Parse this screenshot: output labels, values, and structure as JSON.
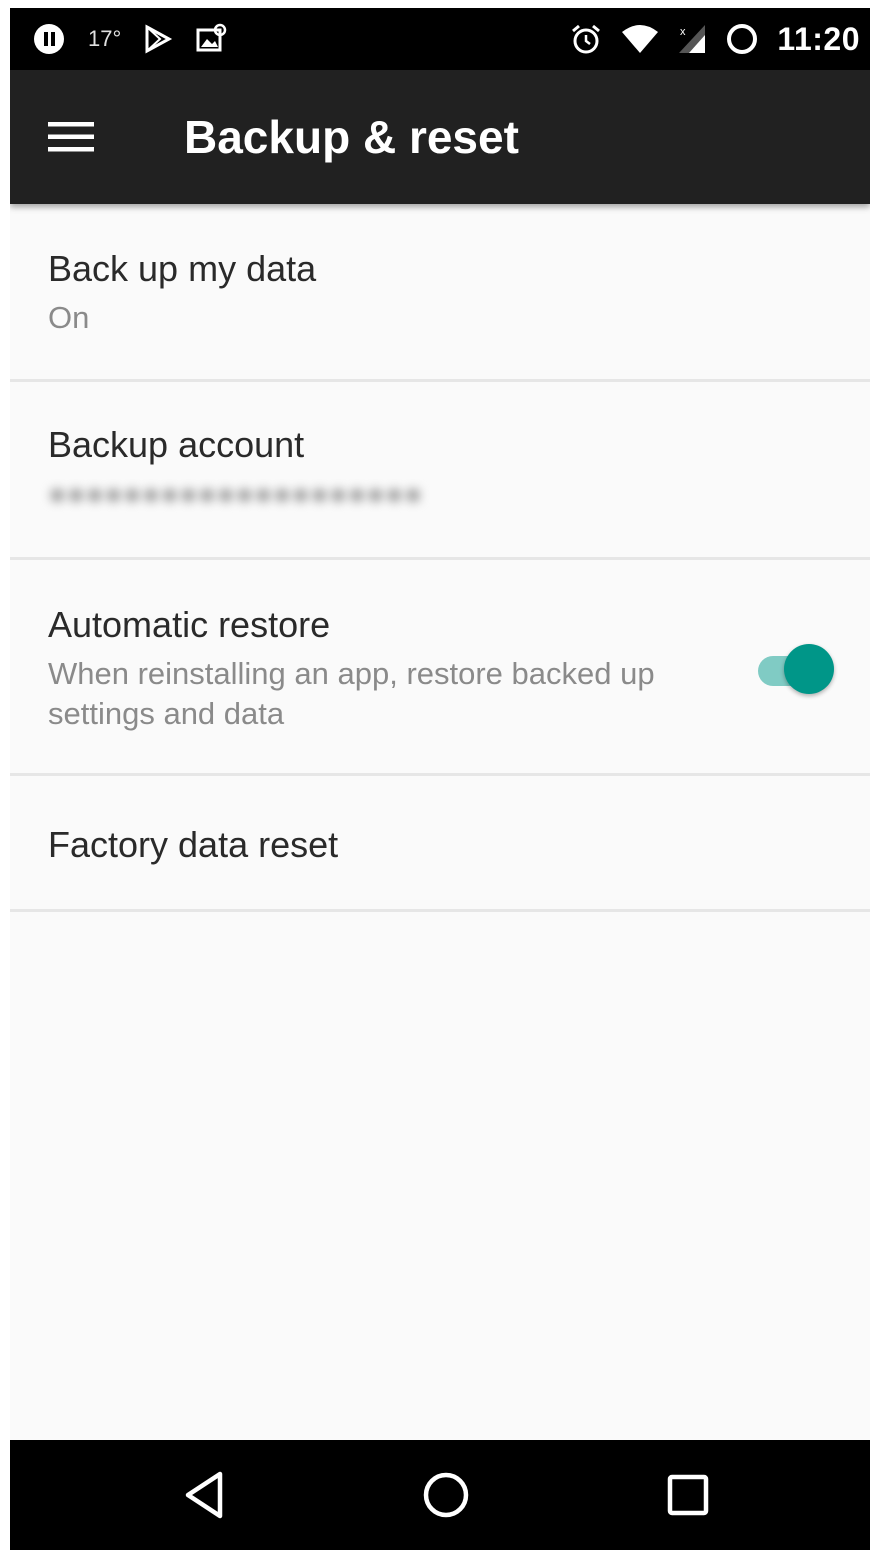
{
  "status_bar": {
    "time": "11:20",
    "temperature": "17°",
    "icons": [
      "notification-icon",
      "weather-icon",
      "play-store-icon",
      "photo-icon",
      "alarm-icon",
      "wifi-icon",
      "signal-icon",
      "battery-icon"
    ]
  },
  "app_bar": {
    "title": "Backup & reset",
    "menu_icon": "hamburger-menu-icon"
  },
  "settings": {
    "backup_data": {
      "title": "Back up my data",
      "summary": "On"
    },
    "backup_account": {
      "title": "Backup account",
      "summary": "●●●●●●●●●●●●●●●●●●●●"
    },
    "automatic_restore": {
      "title": "Automatic restore",
      "summary": "When reinstalling an app, restore backed up settings and data",
      "enabled": true
    },
    "factory_reset": {
      "title": "Factory data reset"
    }
  },
  "colors": {
    "accent": "#009688",
    "accent_light": "#80cbc4",
    "toolbar": "#212121",
    "status_bar": "#000000",
    "background": "#fafafa"
  },
  "nav_bar": {
    "icons": [
      "back-icon",
      "home-icon",
      "recents-icon"
    ]
  }
}
